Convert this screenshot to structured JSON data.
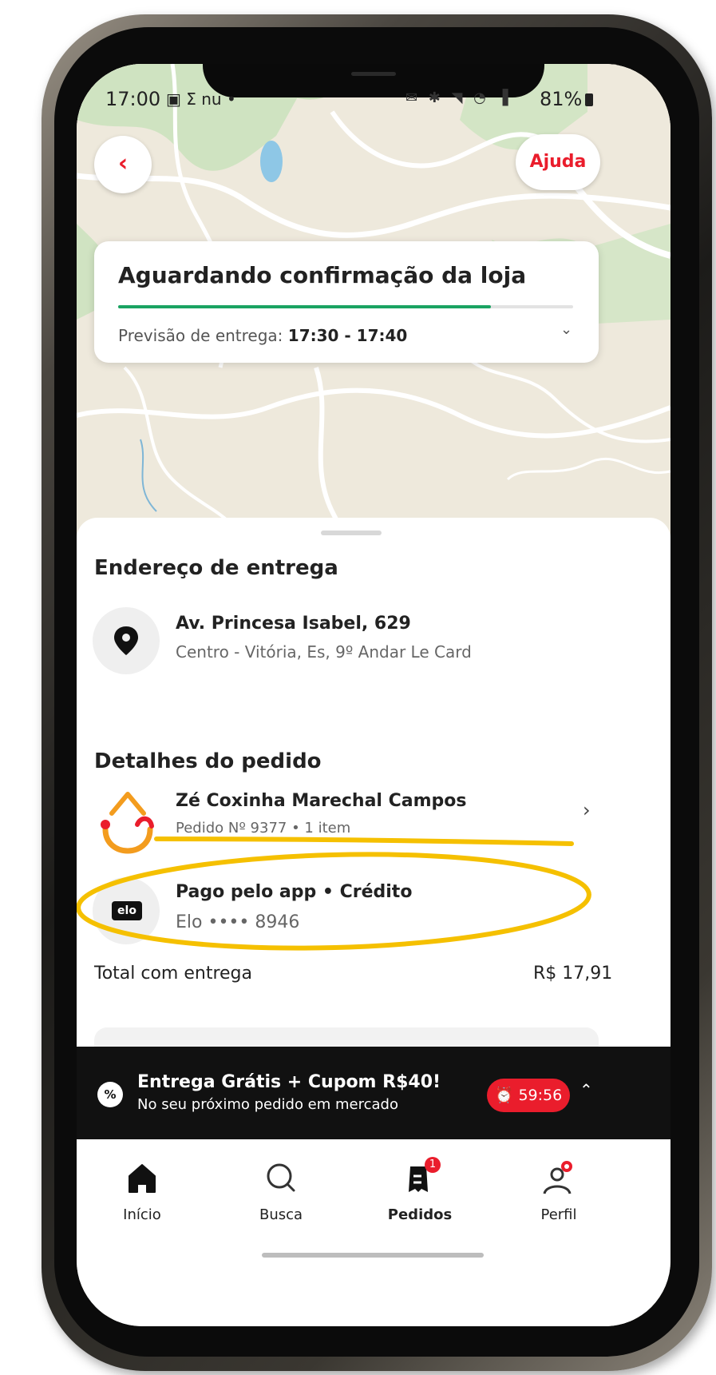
{
  "status_bar": {
    "time": "17:00",
    "left_icons": "▣ Σ nu •",
    "right_icons": "✉ ✱ ◥ ◔ ▐",
    "battery": "81%"
  },
  "header": {
    "back_icon": "‹",
    "help_label": "Ajuda"
  },
  "order_status": {
    "title": "Aguardando confirmação da loja",
    "progress": 0.82,
    "eta_label": "Previsão de entrega:",
    "eta_value": "17:30 - 17:40",
    "expand_icon": "⌄"
  },
  "delivery": {
    "section_title": "Endereço de entrega",
    "address": "Av. Princesa Isabel, 629",
    "complement": "Centro - Vitória, Es, 9º Andar Le Card",
    "icon": "location-pin-icon"
  },
  "order_details": {
    "section_title": "Detalhes do pedido",
    "store_name": "Zé Coxinha Marechal Campos",
    "order_info": "Pedido Nº 9377 • 1 item",
    "payment_method": "Pago pelo app • Crédito",
    "card_info": "Elo •••• 8946",
    "card_brand": "elo"
  },
  "total": {
    "label": "Total com entrega",
    "value": "R$ 17,91"
  },
  "promo": {
    "badge": "%",
    "title": "Entrega Grátis + Cupom R$40!",
    "subtitle": "No seu próximo pedido em mercado",
    "timer": "59:56",
    "timer_icon": "⏰",
    "chevron": "⌃"
  },
  "tabs": [
    {
      "label": "Início",
      "icon": "home-icon"
    },
    {
      "label": "Busca",
      "icon": "search-icon"
    },
    {
      "label": "Pedidos",
      "icon": "orders-icon",
      "badge": "1"
    },
    {
      "label": "Perfil",
      "icon": "profile-icon"
    }
  ],
  "colors": {
    "brand_red": "#ea1d2c",
    "progress_green": "#1aa362",
    "annotation_yellow": "#f5c000"
  }
}
